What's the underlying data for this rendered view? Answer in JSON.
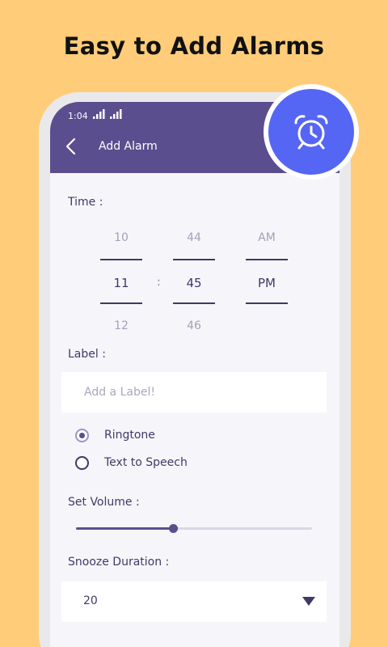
{
  "headline": "Easy to Add Alarms",
  "status_bar": {
    "time": "1:04",
    "icons": [
      "signal-icon",
      "signal-icon"
    ]
  },
  "app_bar": {
    "title": "Add Alarm",
    "back_icon": "back-arrow-icon"
  },
  "badge_icon": "alarm-clock-icon",
  "time_section": {
    "label": "Time :",
    "hours": {
      "prev": "10",
      "selected": "11",
      "next": "12"
    },
    "separator": ":",
    "minutes": {
      "prev": "44",
      "selected": "45",
      "next": "46"
    },
    "period": {
      "prev": "AM",
      "selected": "PM"
    }
  },
  "label_section": {
    "label": "Label :",
    "placeholder": "Add a Label!",
    "value": ""
  },
  "sound_options": [
    {
      "label": "Ringtone",
      "selected": true
    },
    {
      "label": "Text to Speech",
      "selected": false
    }
  ],
  "volume": {
    "label": "Set Volume :",
    "level": 0.41
  },
  "snooze": {
    "label": "Snooze Duration :",
    "value": "20"
  },
  "colors": {
    "background": "#FFCD7A",
    "primary": "#5A4E8E",
    "accent_badge": "#5566F5",
    "text_dark": "#3E3A66",
    "text_dim": "#A3A1B8"
  }
}
